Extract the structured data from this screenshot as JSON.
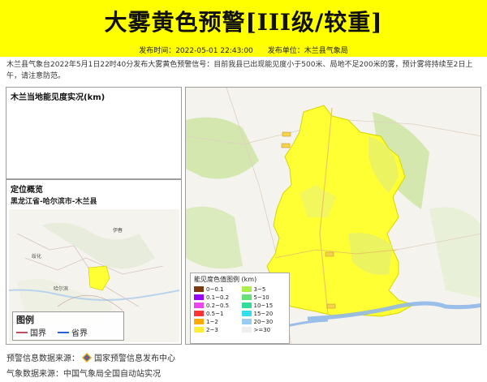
{
  "banner": {
    "title": "大雾黄色预警[III级/较重]",
    "bg_color": "#ffff00"
  },
  "meta": {
    "publish_time_label": "发布时间：2022-05-01 22:43:00",
    "publisher_label": "发布单位：木兰县气象局"
  },
  "description": "木兰县气象台2022年5月1日22时40分发布大雾黄色预警信号：目前我县已出现能见度小于500米、局地不足200米的雾，预计雾将持续至2日上午，请注意防范。",
  "visibility_panel": {
    "title": "木兰当地能见度实况(km)"
  },
  "location_panel": {
    "title": "定位概览",
    "path": "黑龙江省-哈尔滨市-木兰县",
    "map_labels": [
      "伊春",
      "绥化",
      "哈尔滨"
    ],
    "legend": {
      "title": "图例",
      "items": [
        {
          "label": "国界",
          "color": "#c0505e"
        },
        {
          "label": "省界",
          "color": "#2b5fd9"
        }
      ]
    }
  },
  "main_map": {
    "warning_area_color": "#ffff33"
  },
  "visibility_legend": {
    "title": "能见度色值图例 (km)",
    "items": [
      {
        "label": "0~0.1",
        "color": "#7b3a0f"
      },
      {
        "label": "3~5",
        "color": "#a9f04a"
      },
      {
        "label": "0.1~0.2",
        "color": "#9900ff"
      },
      {
        "label": "5~10",
        "color": "#66e07a"
      },
      {
        "label": "0.2~0.5",
        "color": "#ee44ee"
      },
      {
        "label": "10~15",
        "color": "#33dd99"
      },
      {
        "label": "0.5~1",
        "color": "#ff3333"
      },
      {
        "label": "15~20",
        "color": "#33ddee"
      },
      {
        "label": "1~2",
        "color": "#ffaa00"
      },
      {
        "label": "20~30",
        "color": "#99ccee"
      },
      {
        "label": "2~3",
        "color": "#ffee33"
      },
      {
        "label": ">=30",
        "color": "#eeeeee"
      }
    ]
  },
  "footer": {
    "warning_source_label": "预警信息数据来源：",
    "warning_source_name": "国家预警信息发布中心",
    "weather_source_label": "气象数据来源：中国气象局全国自动站实况"
  }
}
